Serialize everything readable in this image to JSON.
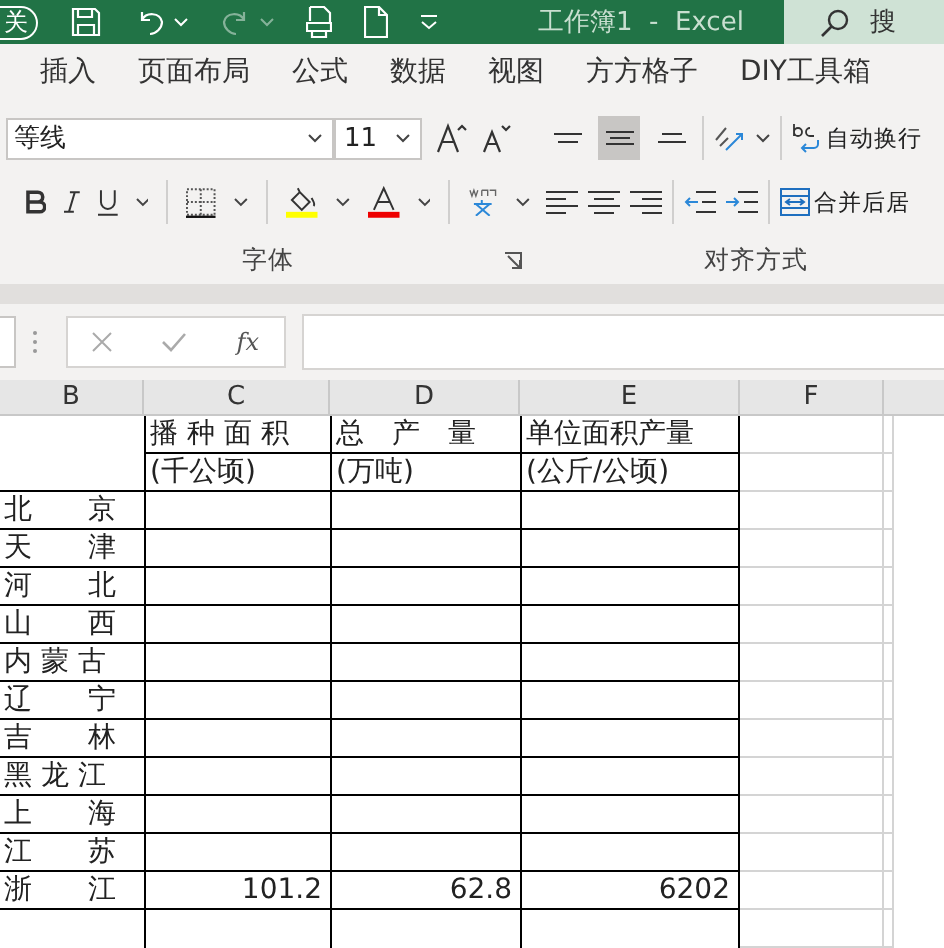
{
  "title_bar": {
    "autosave_label": "关",
    "title": "工作簿1  -  Excel",
    "search_placeholder": "搜"
  },
  "ribbon_tabs": [
    {
      "label": "插入"
    },
    {
      "label": "页面布局"
    },
    {
      "label": "公式"
    },
    {
      "label": "数据"
    },
    {
      "label": "视图"
    },
    {
      "label": "方方格子"
    },
    {
      "label": "DIY工具箱"
    }
  ],
  "ribbon": {
    "font": {
      "font_name": "等线",
      "font_size": "11",
      "group_label": "字体"
    },
    "alignment": {
      "vertical_align": [
        {
          "kind": "top",
          "selected": false
        },
        {
          "kind": "middle",
          "selected": true
        },
        {
          "kind": "bottom",
          "selected": false
        }
      ],
      "wrap_text": "自动换行",
      "merge": "合并后居",
      "group_label": "对齐方式"
    }
  },
  "formula_bar": {
    "function_button": "fx"
  },
  "sheet": {
    "columns": [
      "B",
      "C",
      "D",
      "E",
      "F"
    ],
    "header_rows": [
      {
        "area": "播 种 面 积",
        "output": "总　产　量",
        "yield": "单位面积产量"
      },
      {
        "area": "(千公顷)",
        "output": "(万吨)",
        "yield": "(公斤/公顷)"
      }
    ],
    "rows": [
      {
        "region": "北　　京"
      },
      {
        "region": "天　　津"
      },
      {
        "region": "河　　北"
      },
      {
        "region": "山　　西"
      },
      {
        "region": "内 蒙 古"
      },
      {
        "region": "辽　　宁"
      },
      {
        "region": "吉　　林"
      },
      {
        "region": "黑 龙 江"
      },
      {
        "region": "上　　海"
      },
      {
        "region": "江　　苏"
      },
      {
        "region": "浙　　江",
        "area": "101.2",
        "output": "62.8",
        "yield": "6202"
      }
    ]
  }
}
